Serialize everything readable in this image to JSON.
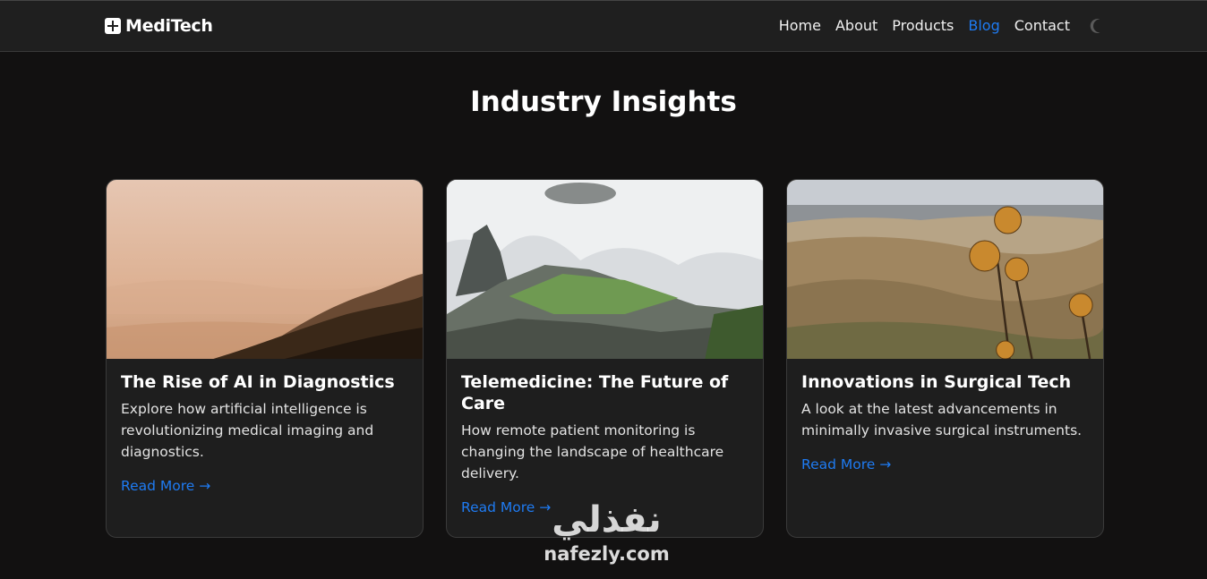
{
  "nav": {
    "brand": "MediTech",
    "links": [
      {
        "label": "Home"
      },
      {
        "label": "About"
      },
      {
        "label": "Products"
      },
      {
        "label": "Blog",
        "active": true
      },
      {
        "label": "Contact"
      }
    ],
    "theme_icon": "moon-icon"
  },
  "section": {
    "title": "Industry Insights"
  },
  "cards": [
    {
      "title": "The Rise of AI in Diagnostics",
      "text": "Explore how artificial intelligence is revolutionizing medical imaging and diagnostics.",
      "link": "Read More →",
      "image": "misty-hills-sunrise-photo"
    },
    {
      "title": "Telemedicine: The Future of Care",
      "text": "How remote patient monitoring is changing the landscape of healthcare delivery.",
      "link": "Read More →",
      "image": "mountain-ruins-in-clouds-photo"
    },
    {
      "title": "Innovations in Surgical Tech",
      "text": "A look at the latest advancements in minimally invasive surgical instruments.",
      "link": "Read More →",
      "image": "thistles-over-valley-photo"
    }
  ],
  "watermark": {
    "arabic": "نفذلي",
    "latin": "nafezly.com"
  },
  "colors": {
    "background": "#121111",
    "navbar": "#1f1f1f",
    "card": "#1e1e1e",
    "accent": "#1e7bf2",
    "text": "#ffffff"
  }
}
